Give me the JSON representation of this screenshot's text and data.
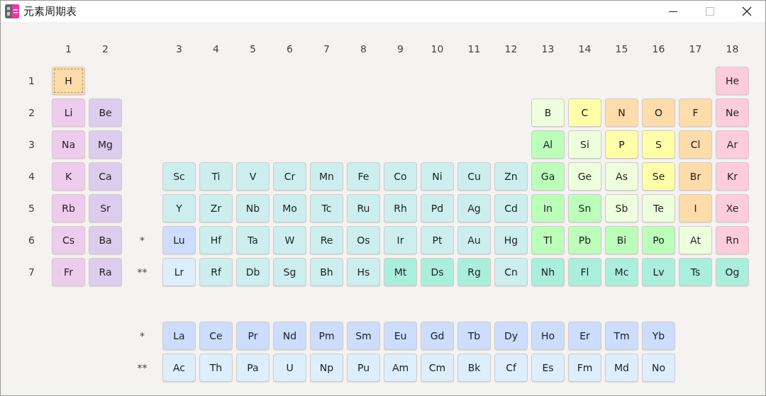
{
  "window": {
    "title": "元素周期表"
  },
  "group_headers": [
    "1",
    "2",
    "3",
    "4",
    "5",
    "6",
    "7",
    "8",
    "9",
    "10",
    "11",
    "12",
    "13",
    "14",
    "15",
    "16",
    "17",
    "18"
  ],
  "periods": [
    {
      "label": "1",
      "left": [
        {
          "symbol": "H",
          "color": "#ffdcaa",
          "selected": true
        }
      ],
      "right": [
        {
          "symbol": "He",
          "color": "#ffccdd",
          "selected": false
        }
      ]
    },
    {
      "label": "2",
      "left": [
        {
          "symbol": "Li",
          "color": "#eeccee",
          "selected": false
        },
        {
          "symbol": "Be",
          "color": "#ddccee",
          "selected": false
        }
      ],
      "right": [
        {
          "symbol": "B",
          "color": "#eeffdd",
          "selected": false
        },
        {
          "symbol": "C",
          "color": "#ffffaa",
          "selected": false
        },
        {
          "symbol": "N",
          "color": "#ffdcaa",
          "selected": false
        },
        {
          "symbol": "O",
          "color": "#ffdcaa",
          "selected": false
        },
        {
          "symbol": "F",
          "color": "#ffdcaa",
          "selected": false
        },
        {
          "symbol": "Ne",
          "color": "#ffccdd",
          "selected": false
        }
      ]
    },
    {
      "label": "3",
      "left": [
        {
          "symbol": "Na",
          "color": "#eeccee",
          "selected": false
        },
        {
          "symbol": "Mg",
          "color": "#ddccee",
          "selected": false
        }
      ],
      "right": [
        {
          "symbol": "Al",
          "color": "#bbffbb",
          "selected": false
        },
        {
          "symbol": "Si",
          "color": "#eeffdd",
          "selected": false
        },
        {
          "symbol": "P",
          "color": "#ffffaa",
          "selected": false
        },
        {
          "symbol": "S",
          "color": "#ffffaa",
          "selected": false
        },
        {
          "symbol": "Cl",
          "color": "#ffdcaa",
          "selected": false
        },
        {
          "symbol": "Ar",
          "color": "#ffccdd",
          "selected": false
        }
      ]
    },
    {
      "label": "4",
      "left": [
        {
          "symbol": "K",
          "color": "#eeccee",
          "selected": false
        },
        {
          "symbol": "Ca",
          "color": "#ddccee",
          "selected": false
        }
      ],
      "right": [
        {
          "symbol": "Sc",
          "color": "#cceeee",
          "selected": false
        },
        {
          "symbol": "Ti",
          "color": "#cceeee",
          "selected": false
        },
        {
          "symbol": "V",
          "color": "#cceeee",
          "selected": false
        },
        {
          "symbol": "Cr",
          "color": "#cceeee",
          "selected": false
        },
        {
          "symbol": "Mn",
          "color": "#cceeee",
          "selected": false
        },
        {
          "symbol": "Fe",
          "color": "#cceeee",
          "selected": false
        },
        {
          "symbol": "Co",
          "color": "#cceeee",
          "selected": false
        },
        {
          "symbol": "Ni",
          "color": "#cceeee",
          "selected": false
        },
        {
          "symbol": "Cu",
          "color": "#cceeee",
          "selected": false
        },
        {
          "symbol": "Zn",
          "color": "#cceeee",
          "selected": false
        },
        {
          "symbol": "Ga",
          "color": "#bbffbb",
          "selected": false
        },
        {
          "symbol": "Ge",
          "color": "#eeffdd",
          "selected": false
        },
        {
          "symbol": "As",
          "color": "#eeffdd",
          "selected": false
        },
        {
          "symbol": "Se",
          "color": "#ffffaa",
          "selected": false
        },
        {
          "symbol": "Br",
          "color": "#ffdcaa",
          "selected": false
        },
        {
          "symbol": "Kr",
          "color": "#ffccdd",
          "selected": false
        }
      ]
    },
    {
      "label": "5",
      "left": [
        {
          "symbol": "Rb",
          "color": "#eeccee",
          "selected": false
        },
        {
          "symbol": "Sr",
          "color": "#ddccee",
          "selected": false
        }
      ],
      "right": [
        {
          "symbol": "Y",
          "color": "#cceeee",
          "selected": false
        },
        {
          "symbol": "Zr",
          "color": "#cceeee",
          "selected": false
        },
        {
          "symbol": "Nb",
          "color": "#cceeee",
          "selected": false
        },
        {
          "symbol": "Mo",
          "color": "#cceeee",
          "selected": false
        },
        {
          "symbol": "Tc",
          "color": "#cceeee",
          "selected": false
        },
        {
          "symbol": "Ru",
          "color": "#cceeee",
          "selected": false
        },
        {
          "symbol": "Rh",
          "color": "#cceeee",
          "selected": false
        },
        {
          "symbol": "Pd",
          "color": "#cceeee",
          "selected": false
        },
        {
          "symbol": "Ag",
          "color": "#cceeee",
          "selected": false
        },
        {
          "symbol": "Cd",
          "color": "#cceeee",
          "selected": false
        },
        {
          "symbol": "In",
          "color": "#bbffbb",
          "selected": false
        },
        {
          "symbol": "Sn",
          "color": "#bbffbb",
          "selected": false
        },
        {
          "symbol": "Sb",
          "color": "#eeffdd",
          "selected": false
        },
        {
          "symbol": "Te",
          "color": "#eeffdd",
          "selected": false
        },
        {
          "symbol": "I",
          "color": "#ffdcaa",
          "selected": false
        },
        {
          "symbol": "Xe",
          "color": "#ffccdd",
          "selected": false
        }
      ]
    },
    {
      "label": "6",
      "marker": "*",
      "left": [
        {
          "symbol": "Cs",
          "color": "#eeccee",
          "selected": false
        },
        {
          "symbol": "Ba",
          "color": "#ddccee",
          "selected": false
        }
      ],
      "right": [
        {
          "symbol": "Lu",
          "color": "#ccddff",
          "selected": false
        },
        {
          "symbol": "Hf",
          "color": "#cceeee",
          "selected": false
        },
        {
          "symbol": "Ta",
          "color": "#cceeee",
          "selected": false
        },
        {
          "symbol": "W",
          "color": "#cceeee",
          "selected": false
        },
        {
          "symbol": "Re",
          "color": "#cceeee",
          "selected": false
        },
        {
          "symbol": "Os",
          "color": "#cceeee",
          "selected": false
        },
        {
          "symbol": "Ir",
          "color": "#cceeee",
          "selected": false
        },
        {
          "symbol": "Pt",
          "color": "#cceeee",
          "selected": false
        },
        {
          "symbol": "Au",
          "color": "#cceeee",
          "selected": false
        },
        {
          "symbol": "Hg",
          "color": "#cceeee",
          "selected": false
        },
        {
          "symbol": "Tl",
          "color": "#bbffbb",
          "selected": false
        },
        {
          "symbol": "Pb",
          "color": "#bbffbb",
          "selected": false
        },
        {
          "symbol": "Bi",
          "color": "#bbffbb",
          "selected": false
        },
        {
          "symbol": "Po",
          "color": "#bbffbb",
          "selected": false
        },
        {
          "symbol": "At",
          "color": "#eeffdd",
          "selected": false
        },
        {
          "symbol": "Rn",
          "color": "#ffccdd",
          "selected": false
        }
      ]
    },
    {
      "label": "7",
      "marker": "**",
      "left": [
        {
          "symbol": "Fr",
          "color": "#eeccee",
          "selected": false
        },
        {
          "symbol": "Ra",
          "color": "#ddccee",
          "selected": false
        }
      ],
      "right": [
        {
          "symbol": "Lr",
          "color": "#ddeeff",
          "selected": false
        },
        {
          "symbol": "Rf",
          "color": "#cceeee",
          "selected": false
        },
        {
          "symbol": "Db",
          "color": "#cceeee",
          "selected": false
        },
        {
          "symbol": "Sg",
          "color": "#cceeee",
          "selected": false
        },
        {
          "symbol": "Bh",
          "color": "#cceeee",
          "selected": false
        },
        {
          "symbol": "Hs",
          "color": "#cceeee",
          "selected": false
        },
        {
          "symbol": "Mt",
          "color": "#aaeedd",
          "selected": false
        },
        {
          "symbol": "Ds",
          "color": "#aaeedd",
          "selected": false
        },
        {
          "symbol": "Rg",
          "color": "#aaeedd",
          "selected": false
        },
        {
          "symbol": "Cn",
          "color": "#cceeee",
          "selected": false
        },
        {
          "symbol": "Nh",
          "color": "#aaeedd",
          "selected": false
        },
        {
          "symbol": "Fl",
          "color": "#aaeedd",
          "selected": false
        },
        {
          "symbol": "Mc",
          "color": "#aaeedd",
          "selected": false
        },
        {
          "symbol": "Lv",
          "color": "#aaeedd",
          "selected": false
        },
        {
          "symbol": "Ts",
          "color": "#aaeedd",
          "selected": false
        },
        {
          "symbol": "Og",
          "color": "#aaeedd",
          "selected": false
        }
      ]
    }
  ],
  "series_rows": [
    {
      "marker": "*",
      "elements": [
        {
          "symbol": "La",
          "color": "#ccddff",
          "selected": false
        },
        {
          "symbol": "Ce",
          "color": "#ccddff",
          "selected": false
        },
        {
          "symbol": "Pr",
          "color": "#ccddff",
          "selected": false
        },
        {
          "symbol": "Nd",
          "color": "#ccddff",
          "selected": false
        },
        {
          "symbol": "Pm",
          "color": "#ccddff",
          "selected": false
        },
        {
          "symbol": "Sm",
          "color": "#ccddff",
          "selected": false
        },
        {
          "symbol": "Eu",
          "color": "#ccddff",
          "selected": false
        },
        {
          "symbol": "Gd",
          "color": "#ccddff",
          "selected": false
        },
        {
          "symbol": "Tb",
          "color": "#ccddff",
          "selected": false
        },
        {
          "symbol": "Dy",
          "color": "#ccddff",
          "selected": false
        },
        {
          "symbol": "Ho",
          "color": "#ccddff",
          "selected": false
        },
        {
          "symbol": "Er",
          "color": "#ccddff",
          "selected": false
        },
        {
          "symbol": "Tm",
          "color": "#ccddff",
          "selected": false
        },
        {
          "symbol": "Yb",
          "color": "#ccddff",
          "selected": false
        }
      ]
    },
    {
      "marker": "**",
      "elements": [
        {
          "symbol": "Ac",
          "color": "#ddeeff",
          "selected": false
        },
        {
          "symbol": "Th",
          "color": "#ddeeff",
          "selected": false
        },
        {
          "symbol": "Pa",
          "color": "#ddeeff",
          "selected": false
        },
        {
          "symbol": "U",
          "color": "#ddeeff",
          "selected": false
        },
        {
          "symbol": "Np",
          "color": "#ddeeff",
          "selected": false
        },
        {
          "symbol": "Pu",
          "color": "#ddeeff",
          "selected": false
        },
        {
          "symbol": "Am",
          "color": "#ddeeff",
          "selected": false
        },
        {
          "symbol": "Cm",
          "color": "#ddeeff",
          "selected": false
        },
        {
          "symbol": "Bk",
          "color": "#ddeeff",
          "selected": false
        },
        {
          "symbol": "Cf",
          "color": "#ddeeff",
          "selected": false
        },
        {
          "symbol": "Es",
          "color": "#ddeeff",
          "selected": false
        },
        {
          "symbol": "Fm",
          "color": "#ddeeff",
          "selected": false
        },
        {
          "symbol": "Md",
          "color": "#ddeeff",
          "selected": false
        },
        {
          "symbol": "No",
          "color": "#ddeeff",
          "selected": false
        }
      ]
    }
  ]
}
